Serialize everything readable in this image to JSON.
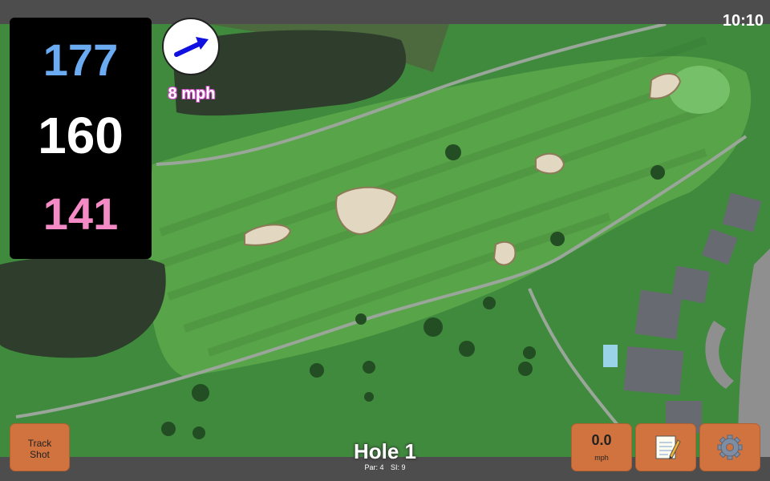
{
  "status": {
    "time": "10:10"
  },
  "distances": {
    "back": "177",
    "center": "160",
    "front": "141"
  },
  "wind": {
    "speed_label": "8 mph",
    "icon": "arrow-right-icon"
  },
  "buttons": {
    "track_shot": "Track\nShot",
    "track_shot_line1": "Track",
    "track_shot_line2": "Shot",
    "speed_value": "0.0",
    "speed_unit": "mph",
    "notes_icon": "notepad-icon",
    "settings_icon": "gear-icon"
  },
  "hole": {
    "title": "Hole 1",
    "par": "Par: 4",
    "si": "SI: 9"
  },
  "colors": {
    "back_distance": "#6aabf2",
    "center_distance": "#ffffff",
    "front_distance": "#f58bc6",
    "button": "#d0733e",
    "fairway": "#58a448",
    "rough": "#3f8a3d",
    "water": "#2e3d2c",
    "bunker": "#e2d7c0",
    "cart_path": "#9aa69a"
  }
}
